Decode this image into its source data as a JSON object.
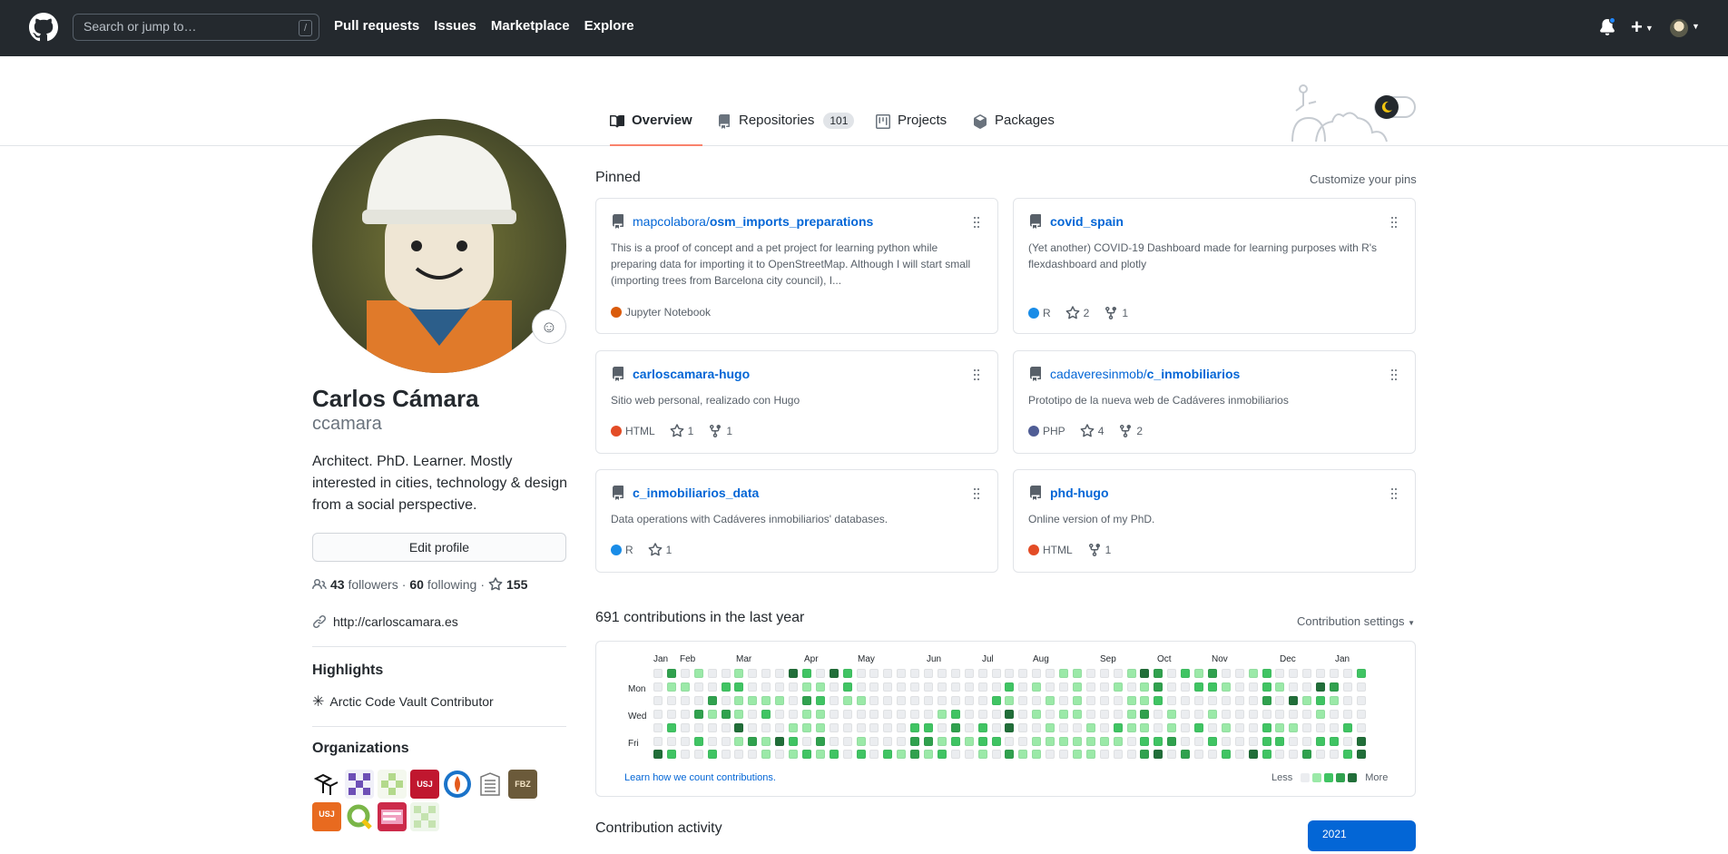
{
  "header": {
    "search_placeholder": "Search or jump to…",
    "search_shortcut": "/",
    "nav": [
      "Pull requests",
      "Issues",
      "Marketplace",
      "Explore"
    ],
    "plus_label": "+"
  },
  "tabs": [
    {
      "label": "Overview",
      "active": true
    },
    {
      "label": "Repositories",
      "count": "101"
    },
    {
      "label": "Projects"
    },
    {
      "label": "Packages"
    }
  ],
  "profile": {
    "name": "Carlos Cámara",
    "login": "ccamara",
    "bio": "Architect. PhD. Learner. Mostly interested in cities, technology & design from a social perspective.",
    "edit_label": "Edit profile",
    "followers_count": "43",
    "followers_label": "followers",
    "sep": "·",
    "following_count": "60",
    "following_label": "following",
    "stars_count": "155",
    "website": "http://carloscamara.es"
  },
  "highlights": {
    "heading": "Highlights",
    "items": [
      "Arctic Code Vault Contributor"
    ]
  },
  "organizations": {
    "heading": "Organizations",
    "logo_texts": [
      "USJ",
      "FBZ",
      "USJ"
    ]
  },
  "pinned": {
    "heading": "Pinned",
    "customize_label": "Customize your pins",
    "items": [
      {
        "owner": "mapcolabora/",
        "repo": "osm_imports_preparations",
        "desc": "This is a proof of concept and a pet project for learning python while preparing data for importing it to OpenStreetMap. Although I will start small (importing trees from Barcelona city council), I...",
        "lang": "Jupyter Notebook",
        "lang_color": "#DA5B0B",
        "stars": "",
        "forks": ""
      },
      {
        "owner": "",
        "repo": "covid_spain",
        "desc": "(Yet another) COVID-19 Dashboard made for learning purposes with R's flexdashboard and plotly",
        "lang": "R",
        "lang_color": "#198CE7",
        "stars": "2",
        "forks": "1"
      },
      {
        "owner": "",
        "repo": "carloscamara-hugo",
        "desc": "Sitio web personal, realizado con Hugo",
        "lang": "HTML",
        "lang_color": "#e34c26",
        "stars": "1",
        "forks": "1"
      },
      {
        "owner": "cadaveresinmob/",
        "repo": "c_inmobiliarios",
        "desc": "Prototipo de la nueva web de Cadáveres inmobiliarios",
        "lang": "PHP",
        "lang_color": "#4F5D95",
        "stars": "4",
        "forks": "2"
      },
      {
        "owner": "",
        "repo": "c_inmobiliarios_data",
        "desc": "Data operations with Cadáveres inmobiliarios' databases.",
        "lang": "R",
        "lang_color": "#198CE7",
        "stars": "1",
        "forks": ""
      },
      {
        "owner": "",
        "repo": "phd-hugo",
        "desc": "Online version of my PhD.",
        "lang": "HTML",
        "lang_color": "#e34c26",
        "stars": "",
        "forks": "1"
      }
    ]
  },
  "contributions": {
    "heading": "691 contributions in the last year",
    "settings_label": "Contribution settings",
    "months": [
      "Jan",
      "Feb",
      "Mar",
      "Apr",
      "May",
      "Jun",
      "Jul",
      "Aug",
      "Sep",
      "Oct",
      "Nov",
      "Dec",
      "Jan"
    ],
    "days": [
      "Mon",
      "Wed",
      "Fri"
    ],
    "learn_link": "Learn how we count contributions.",
    "legend_less": "Less",
    "legend_more": "More",
    "colors": [
      "#ebedf0",
      "#9be9a8",
      "#40c463",
      "#30a14e",
      "#216e39"
    ]
  },
  "activity": {
    "heading": "Contribution activity",
    "year": "2021"
  }
}
